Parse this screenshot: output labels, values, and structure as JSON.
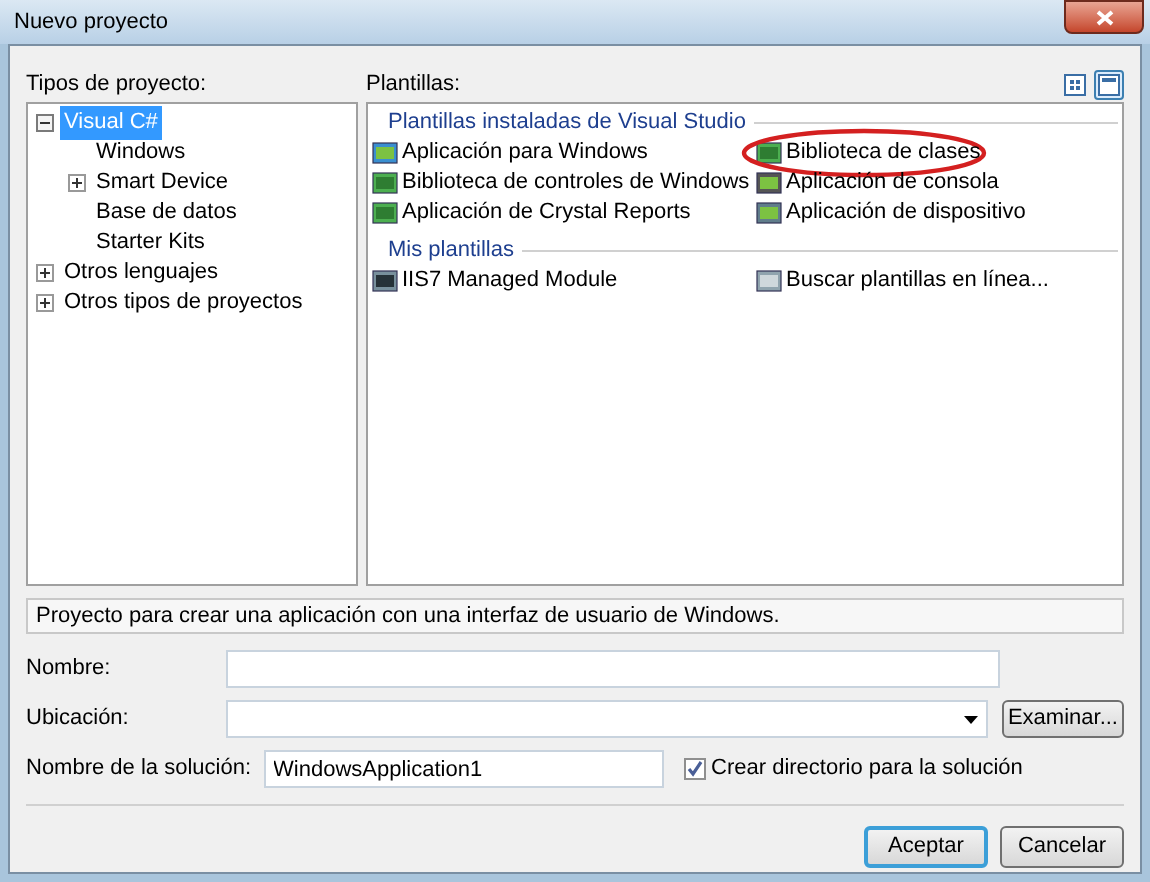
{
  "window": {
    "title": "Nuevo proyecto"
  },
  "project_types": {
    "label": "Tipos de proyecto:",
    "tree": [
      {
        "label": "Visual C#",
        "selected": true,
        "expanded": true,
        "children": [
          {
            "label": "Windows",
            "selected": false
          },
          {
            "label": "Smart Device",
            "selected": false,
            "expanded": false
          },
          {
            "label": "Base de datos",
            "selected": false
          },
          {
            "label": "Starter Kits",
            "selected": false
          }
        ]
      },
      {
        "label": "Otros lenguajes",
        "selected": false,
        "expanded": false
      },
      {
        "label": "Otros tipos de proyectos",
        "selected": false,
        "expanded": false
      }
    ]
  },
  "templates": {
    "label": "Plantillas:",
    "view_buttons": [
      {
        "kind": "small-icons",
        "selected": false
      },
      {
        "kind": "large-icons",
        "selected": true
      }
    ],
    "groups": [
      {
        "title": "Plantillas instaladas de Visual Studio",
        "items": [
          {
            "label": "Aplicación para Windows",
            "kind": "app",
            "circled": false
          },
          {
            "label": "Biblioteca de clases",
            "kind": "lib",
            "circled": true
          },
          {
            "label": "Biblioteca de controles de Windows",
            "kind": "lib",
            "circled": false
          },
          {
            "label": "Aplicación de consola",
            "kind": "console",
            "circled": false
          },
          {
            "label": "Aplicación de Crystal Reports",
            "kind": "lib",
            "circled": false
          },
          {
            "label": "Aplicación de dispositivo",
            "kind": "device",
            "circled": false
          }
        ]
      },
      {
        "title": "Mis plantillas",
        "items": [
          {
            "label": "IIS7 Managed Module",
            "kind": "module",
            "circled": false
          },
          {
            "label": "Buscar plantillas en línea...",
            "kind": "search",
            "circled": false
          }
        ]
      }
    ]
  },
  "description": "Proyecto para crear una aplicación con una interfaz de usuario de Windows.",
  "fields": [
    {
      "label": "Nombre:",
      "kind": "text"
    },
    {
      "label": "Ubicación:",
      "kind": "combo",
      "button": "Examinar..."
    },
    {
      "label": "Nombre de la solución:",
      "kind": "solution",
      "value": "WindowsApplication1",
      "checkbox": {
        "label": "Crear directorio para la solución",
        "checked": true
      }
    }
  ],
  "buttons": [
    {
      "label": "Aceptar",
      "default": true
    },
    {
      "label": "Cancelar",
      "default": false
    }
  ]
}
